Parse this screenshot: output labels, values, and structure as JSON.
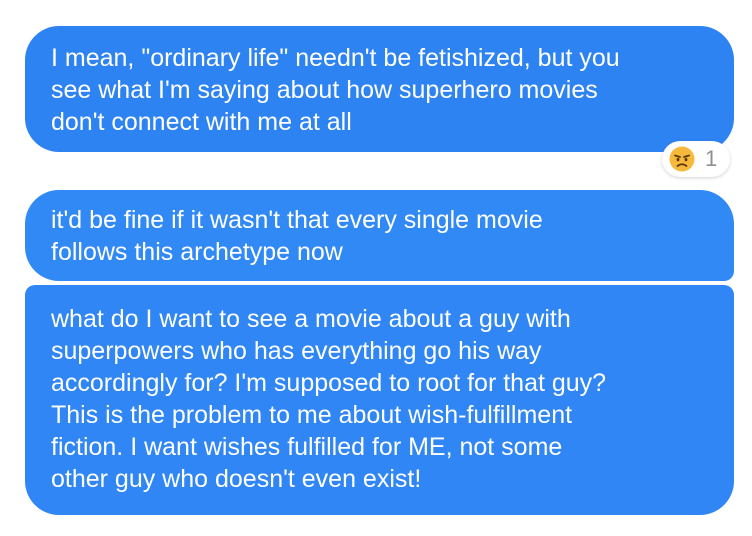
{
  "messages": [
    {
      "text": "I mean, \"ordinary life\" needn't be fetishized, but you\nsee what I'm saying about how superhero movies\ndon't connect with me at all",
      "reaction": {
        "icon": "angry-face-emoji",
        "count": "1"
      }
    },
    {
      "text": "it'd be fine if it wasn't that every single movie\nfollows this archetype now"
    },
    {
      "text": "what do I want to see a movie about a guy with\nsuperpowers who has everything go his way\naccordingly for? I'm supposed to root for that guy?\nThis is the problem to me about wish-fulfillment\nfiction. I want wishes fulfilled for ME, not some\nother guy who doesn't even exist!"
    }
  ],
  "colors": {
    "bubble": "#2e83f3",
    "bubble_text": "#ffffff",
    "background": "#ffffff",
    "reaction_count": "#8e8e93"
  }
}
